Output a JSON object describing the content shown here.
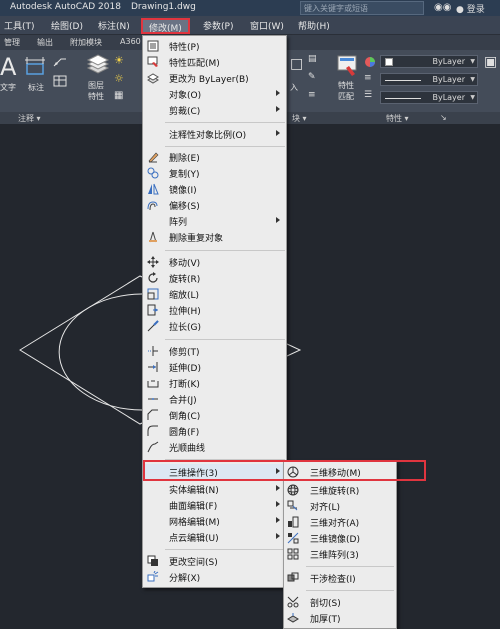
{
  "window": {
    "app_title": "Autodesk AutoCAD 2018",
    "file_name": "Drawing1.dwg",
    "search_placeholder": "键入关键字或短语",
    "login": "登录",
    "binoculars_icon": "binoculars-icon"
  },
  "menubar": {
    "items": [
      "工具(T)",
      "绘图(D)",
      "标注(N)",
      "修改(M)",
      "参数(P)",
      "窗口(W)",
      "帮助(H)"
    ],
    "active_index": 3
  },
  "ribbon_tabs": [
    "管理",
    "输出",
    "附加模块",
    "A360"
  ],
  "ribbon": {
    "text_label": "文字",
    "dim_label": "标注",
    "layer_props_label": "图层\n特性",
    "insert_label": "入",
    "match_props_label": "特性\n匹配",
    "bylayer_values": [
      "ByLayer",
      "ByLayer",
      "ByLayer"
    ],
    "footer": {
      "annotation": "注释",
      "block": "块",
      "properties": "特性"
    }
  },
  "modify_menu": {
    "groups": [
      [
        {
          "label": "特性(P)",
          "icon": "properties-icon",
          "submenu": false
        },
        {
          "label": "特性匹配(M)",
          "icon": "match-properties-icon",
          "submenu": false
        },
        {
          "label": "更改为 ByLayer(B)",
          "icon": "change-to-bylayer-icon",
          "submenu": false
        },
        {
          "label": "对象(O)",
          "icon": "",
          "submenu": true
        },
        {
          "label": "剪裁(C)",
          "icon": "",
          "submenu": true
        }
      ],
      [
        {
          "label": "注释性对象比例(O)",
          "icon": "",
          "submenu": true
        }
      ],
      [
        {
          "label": "删除(E)",
          "icon": "erase-icon",
          "submenu": false
        },
        {
          "label": "复制(Y)",
          "icon": "copy-icon",
          "submenu": false
        },
        {
          "label": "镜像(I)",
          "icon": "mirror-icon",
          "submenu": false
        },
        {
          "label": "偏移(S)",
          "icon": "offset-icon",
          "submenu": false
        },
        {
          "label": "阵列",
          "icon": "",
          "submenu": true
        },
        {
          "label": "删除重复对象",
          "icon": "delete-duplicates-icon",
          "submenu": false
        }
      ],
      [
        {
          "label": "移动(V)",
          "icon": "move-icon",
          "submenu": false
        },
        {
          "label": "旋转(R)",
          "icon": "rotate-icon",
          "submenu": false
        },
        {
          "label": "缩放(L)",
          "icon": "scale-icon",
          "submenu": false
        },
        {
          "label": "拉伸(H)",
          "icon": "stretch-icon",
          "submenu": false
        },
        {
          "label": "拉长(G)",
          "icon": "lengthen-icon",
          "submenu": false
        }
      ],
      [
        {
          "label": "修剪(T)",
          "icon": "trim-icon",
          "submenu": false
        },
        {
          "label": "延伸(D)",
          "icon": "extend-icon",
          "submenu": false
        },
        {
          "label": "打断(K)",
          "icon": "break-icon",
          "submenu": false
        },
        {
          "label": "合并(J)",
          "icon": "join-icon",
          "submenu": false
        },
        {
          "label": "倒角(C)",
          "icon": "chamfer-icon",
          "submenu": false
        },
        {
          "label": "圆角(F)",
          "icon": "fillet-icon",
          "submenu": false
        },
        {
          "label": "光顺曲线",
          "icon": "blend-curves-icon",
          "submenu": false
        }
      ],
      [
        {
          "label": "三维操作(3)",
          "icon": "",
          "submenu": true,
          "highlighted": true
        },
        {
          "label": "实体编辑(N)",
          "icon": "",
          "submenu": true
        },
        {
          "label": "曲面编辑(F)",
          "icon": "",
          "submenu": true
        },
        {
          "label": "网格编辑(M)",
          "icon": "",
          "submenu": true
        },
        {
          "label": "点云编辑(U)",
          "icon": "",
          "submenu": true
        }
      ],
      [
        {
          "label": "更改空间(S)",
          "icon": "change-space-icon",
          "submenu": false
        },
        {
          "label": "分解(X)",
          "icon": "explode-icon",
          "submenu": false
        }
      ]
    ]
  },
  "submenu_3d": {
    "groups": [
      [
        {
          "label": "三维移动(M)",
          "icon": "3d-move-icon"
        },
        {
          "label": "三维旋转(R)",
          "icon": "3d-rotate-icon"
        },
        {
          "label": "对齐(L)",
          "icon": "align-icon"
        },
        {
          "label": "三维对齐(A)",
          "icon": "3d-align-icon"
        },
        {
          "label": "三维镜像(D)",
          "icon": "3d-mirror-icon"
        },
        {
          "label": "三维阵列(3)",
          "icon": "3d-array-icon"
        }
      ],
      [
        {
          "label": "干涉检查(I)",
          "icon": "interference-check-icon"
        }
      ],
      [
        {
          "label": "剖切(S)",
          "icon": "slice-icon"
        },
        {
          "label": "加厚(T)",
          "icon": "thicken-icon"
        }
      ]
    ]
  },
  "colors": {
    "highlight_red": "#e0353f",
    "menu_bg": "#ececec",
    "canvas_bg": "#23272e"
  }
}
